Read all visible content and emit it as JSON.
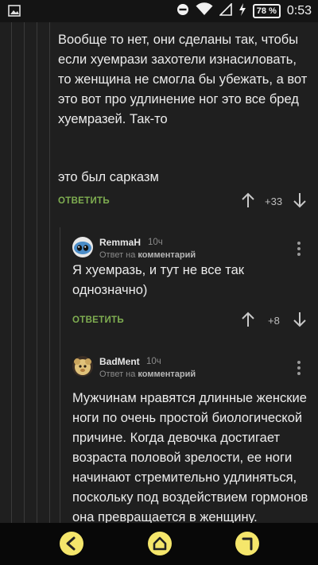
{
  "status_bar": {
    "battery": "78 %",
    "time": "0:53"
  },
  "comments": [
    {
      "text_lines": [
        "Вообще то нет, они сделаны так, чтобы",
        "если хуемрази захотели изнасиловать,",
        "то женщина не смогла бы убежать, а вот",
        "это вот про удлинение ног это все бред",
        "хуемразей. Так-то"
      ],
      "text2": "это был сарказм",
      "reply_label": "ОТВЕТИТЬ",
      "score": "+33"
    },
    {
      "author": "RemmaH",
      "time": "10ч",
      "reply_to_prefix": "Ответ на",
      "reply_to_target": "комментарий",
      "text_lines": [
        "Я хуемразь, и тут не все так",
        "однозначно)"
      ],
      "reply_label": "ОТВЕТИТЬ",
      "score": "+8"
    },
    {
      "author": "BadMent",
      "time": "10ч",
      "reply_to_prefix": "Ответ на",
      "reply_to_target": "комментарий",
      "text_lines": [
        "Мужчинам нравятся длинные женские",
        "ноги по очень простой биологической",
        "причине. Когда девочка достигает",
        "возраста половой зрелости, ее ноги",
        "начинают стремительно удлиняться,",
        "поскольку под воздействием гормонов",
        "она превращается в женщину."
      ]
    }
  ],
  "colors": {
    "background": "#1f1f1f",
    "reply_green": "#7fae51",
    "nav_button_yellow": "#f5e66b"
  },
  "icons": [
    "image-icon",
    "dnd-icon",
    "wifi-icon",
    "signal-icon",
    "charging-icon",
    "battery-icon",
    "upvote-icon",
    "downvote-icon",
    "more-icon",
    "back-icon",
    "home-icon",
    "recents-icon"
  ]
}
